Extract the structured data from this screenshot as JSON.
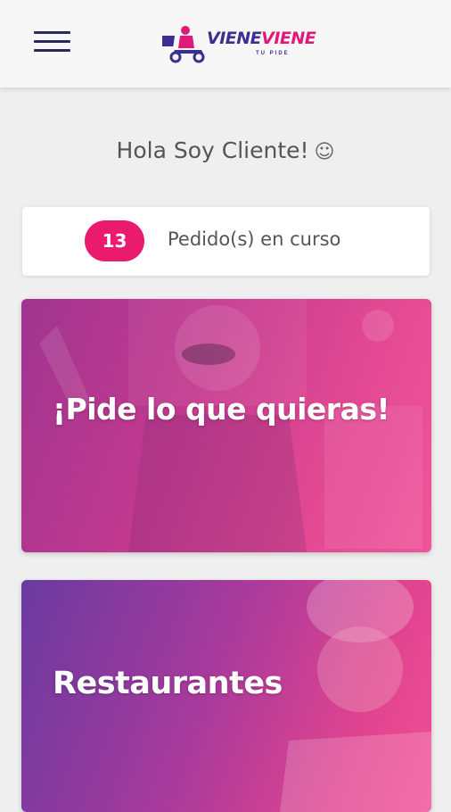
{
  "header": {
    "menu_icon": "hamburger-menu-icon",
    "logo": {
      "word1": "VIENE",
      "word2": "VIENE",
      "tagline": "TU PIDE"
    }
  },
  "greeting": {
    "text": "Hola Soy Cliente!",
    "emoji": "☺"
  },
  "orders": {
    "count": "13",
    "label": "Pedido(s) en curso",
    "badge_color": "#ea1a6e"
  },
  "cards": [
    {
      "title": "¡Pide lo que quieras!"
    },
    {
      "title": "Restaurantes"
    }
  ],
  "colors": {
    "accent": "#ea1a6e",
    "brand_dark": "#2c2a59"
  }
}
